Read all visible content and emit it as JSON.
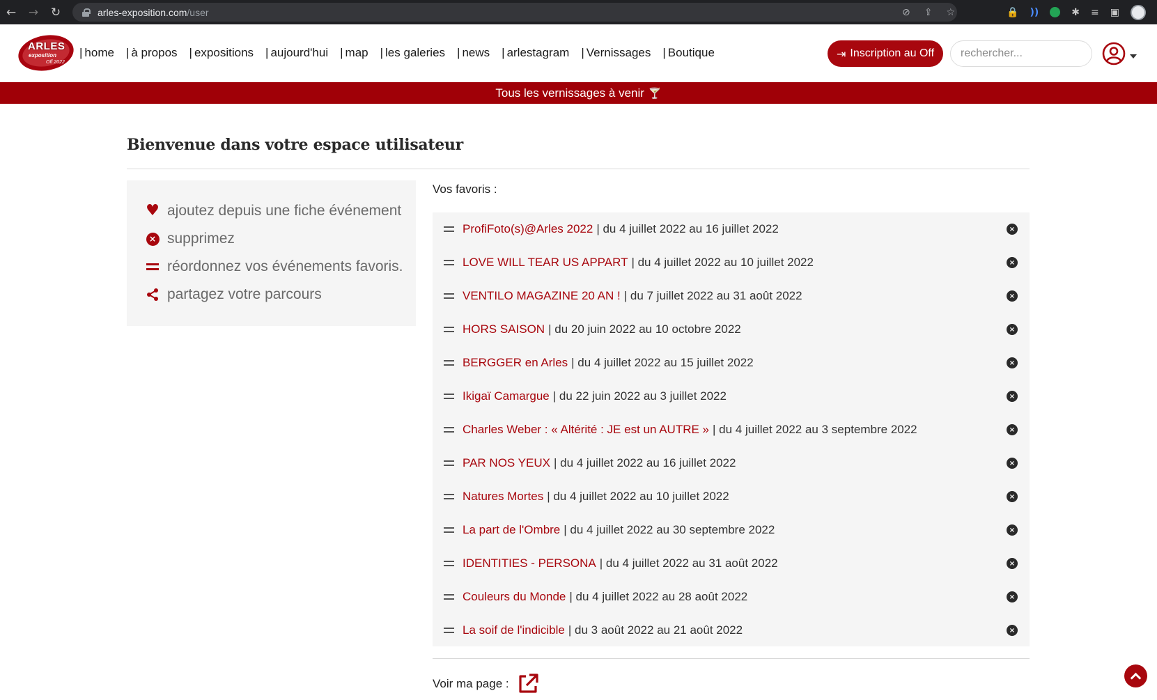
{
  "browser": {
    "url_host": "arles-exposition.com",
    "url_path": "/user"
  },
  "header": {
    "logo": {
      "line1": "ARLES",
      "line2": "exposition",
      "line3": "Off 2022"
    },
    "nav": [
      {
        "label": "home"
      },
      {
        "label": "à propos"
      },
      {
        "label": "expositions"
      },
      {
        "label": "aujourd'hui"
      },
      {
        "label": "map"
      },
      {
        "label": "les galeries"
      },
      {
        "label": "news"
      },
      {
        "label": "arlestagram"
      },
      {
        "label": "Vernissages"
      },
      {
        "label": "Boutique"
      }
    ],
    "signup_label": "Inscription au Off",
    "search_placeholder": "rechercher..."
  },
  "banner": {
    "text": "Tous les vernissages à venir"
  },
  "main": {
    "title": "Bienvenue dans votre espace utilisateur",
    "help": [
      {
        "icon": "heart-icon",
        "text": "ajoutez depuis une fiche événement"
      },
      {
        "icon": "remove-icon",
        "text": "supprimez"
      },
      {
        "icon": "drag-handle-icon",
        "text": "réordonnez vos événements favoris."
      },
      {
        "icon": "share-icon",
        "text": "partagez votre parcours"
      }
    ],
    "favorites_label": "Vos favoris :",
    "favorites": [
      {
        "title": "ProfiFoto(s)@Arles 2022",
        "dates": "| du 4 juillet 2022 au 16 juillet 2022"
      },
      {
        "title": "LOVE WILL TEAR US APPART",
        "dates": "| du 4 juillet 2022 au 10 juillet 2022"
      },
      {
        "title": "VENTILO MAGAZINE 20 AN !",
        "dates": "| du 7 juillet 2022 au 31 août 2022"
      },
      {
        "title": "HORS SAISON",
        "dates": "| du 20 juin 2022 au 10 octobre 2022"
      },
      {
        "title": "BERGGER en Arles",
        "dates": "| du 4 juillet 2022 au 15 juillet 2022"
      },
      {
        "title": "Ikigaï Camargue",
        "dates": "| du 22 juin 2022 au 3 juillet 2022"
      },
      {
        "title": "Charles Weber : « Altérité : JE est un AUTRE »",
        "dates": "| du 4 juillet 2022 au 3 septembre 2022"
      },
      {
        "title": "PAR NOS YEUX",
        "dates": "| du 4 juillet 2022 au 16 juillet 2022"
      },
      {
        "title": "Natures Mortes",
        "dates": "| du 4 juillet 2022 au 10 juillet 2022"
      },
      {
        "title": "La part de l'Ombre",
        "dates": "| du 4 juillet 2022 au 30 septembre 2022"
      },
      {
        "title": "IDENTITIES - PERSONA",
        "dates": "| du 4 juillet 2022 au 31 août 2022"
      },
      {
        "title": "Couleurs du Monde",
        "dates": "| du 4 juillet 2022 au 28 août 2022"
      },
      {
        "title": "La soif de l'indicible",
        "dates": "| du 3 août 2022 au 21 août 2022"
      }
    ],
    "my_page_label": "Voir ma page :"
  },
  "colors": {
    "brand_red": "#a8070e",
    "banner_red": "#a00007",
    "chrome_bg": "#202124"
  }
}
